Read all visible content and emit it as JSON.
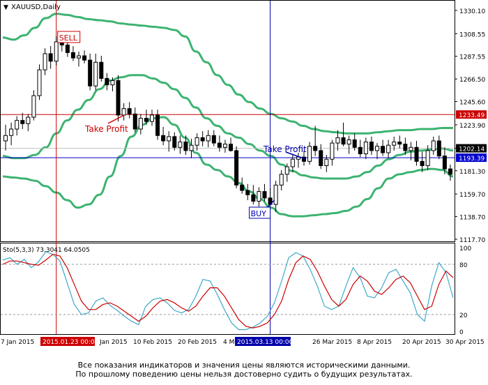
{
  "chart_data": [
    {
      "type": "candlestick",
      "symbol_label": "XAUUSD,Daily",
      "colors": {
        "bull": "#ffffff",
        "bear": "#000000",
        "bollinger": "#3cb371",
        "hline": "#cc0000",
        "vline_sell": "#cc0000",
        "vline_buy": "#0000aa",
        "blue_hline": "#0000cc"
      },
      "x_labels": [
        "7 Jan 2015",
        "Jan 2015",
        "10 Feb 2015",
        "20 Feb 2015",
        "4 M",
        "26 Mar 2015",
        "8 Apr 2015",
        "20 Apr 2015",
        "30 Apr 2015"
      ],
      "x_highlight_left": "2015.01.23 00:00",
      "x_highlight_right": "2015.03.13 00:00",
      "y_ticks": [
        "1330.10",
        "1308.55",
        "1287.55",
        "1266.50",
        "1245.60",
        "1223.90",
        "1202.14",
        "1181.30",
        "1159.70",
        "1138.70",
        "1117.70"
      ],
      "price_markers": [
        {
          "label": "1233.49",
          "color": "#cc0000"
        },
        {
          "label": "1202.14",
          "color": "#000000"
        },
        {
          "label": "1193.39",
          "color": "#0000cc"
        }
      ],
      "annotations": {
        "sell": "SELL",
        "buy": "BUY",
        "take_profit_1": "Take Profit",
        "take_profit_2": "Take Profit"
      },
      "candles": [
        {
          "o": 1209,
          "h": 1224,
          "l": 1200,
          "c": 1214
        },
        {
          "o": 1214,
          "h": 1226,
          "l": 1205,
          "c": 1220
        },
        {
          "o": 1220,
          "h": 1232,
          "l": 1214,
          "c": 1228
        },
        {
          "o": 1228,
          "h": 1235,
          "l": 1220,
          "c": 1225
        },
        {
          "o": 1225,
          "h": 1234,
          "l": 1218,
          "c": 1231
        },
        {
          "o": 1231,
          "h": 1256,
          "l": 1228,
          "c": 1251
        },
        {
          "o": 1251,
          "h": 1280,
          "l": 1247,
          "c": 1275
        },
        {
          "o": 1275,
          "h": 1295,
          "l": 1270,
          "c": 1290
        },
        {
          "o": 1290,
          "h": 1297,
          "l": 1276,
          "c": 1283
        },
        {
          "o": 1283,
          "h": 1306,
          "l": 1279,
          "c": 1301
        },
        {
          "o": 1301,
          "h": 1308,
          "l": 1292,
          "c": 1298
        },
        {
          "o": 1298,
          "h": 1305,
          "l": 1287,
          "c": 1291
        },
        {
          "o": 1291,
          "h": 1297,
          "l": 1283,
          "c": 1286
        },
        {
          "o": 1286,
          "h": 1292,
          "l": 1278,
          "c": 1288
        },
        {
          "o": 1288,
          "h": 1293,
          "l": 1281,
          "c": 1284
        },
        {
          "o": 1284,
          "h": 1290,
          "l": 1256,
          "c": 1260
        },
        {
          "o": 1260,
          "h": 1290,
          "l": 1256,
          "c": 1282
        },
        {
          "o": 1282,
          "h": 1288,
          "l": 1264,
          "c": 1267
        },
        {
          "o": 1267,
          "h": 1272,
          "l": 1256,
          "c": 1261
        },
        {
          "o": 1261,
          "h": 1268,
          "l": 1255,
          "c": 1265
        },
        {
          "o": 1265,
          "h": 1270,
          "l": 1227,
          "c": 1233
        },
        {
          "o": 1233,
          "h": 1244,
          "l": 1228,
          "c": 1239
        },
        {
          "o": 1239,
          "h": 1245,
          "l": 1230,
          "c": 1234
        },
        {
          "o": 1234,
          "h": 1240,
          "l": 1217,
          "c": 1220
        },
        {
          "o": 1220,
          "h": 1234,
          "l": 1215,
          "c": 1230
        },
        {
          "o": 1230,
          "h": 1238,
          "l": 1224,
          "c": 1227
        },
        {
          "o": 1227,
          "h": 1238,
          "l": 1223,
          "c": 1233
        },
        {
          "o": 1233,
          "h": 1238,
          "l": 1210,
          "c": 1214
        },
        {
          "o": 1214,
          "h": 1222,
          "l": 1205,
          "c": 1209
        },
        {
          "o": 1209,
          "h": 1218,
          "l": 1199,
          "c": 1213
        },
        {
          "o": 1213,
          "h": 1217,
          "l": 1200,
          "c": 1203
        },
        {
          "o": 1203,
          "h": 1214,
          "l": 1197,
          "c": 1208
        },
        {
          "o": 1208,
          "h": 1214,
          "l": 1196,
          "c": 1200
        },
        {
          "o": 1200,
          "h": 1211,
          "l": 1193,
          "c": 1205
        },
        {
          "o": 1205,
          "h": 1216,
          "l": 1200,
          "c": 1212
        },
        {
          "o": 1212,
          "h": 1218,
          "l": 1204,
          "c": 1209
        },
        {
          "o": 1209,
          "h": 1219,
          "l": 1203,
          "c": 1214
        },
        {
          "o": 1214,
          "h": 1219,
          "l": 1204,
          "c": 1207
        },
        {
          "o": 1207,
          "h": 1214,
          "l": 1199,
          "c": 1203
        },
        {
          "o": 1203,
          "h": 1210,
          "l": 1198,
          "c": 1206
        },
        {
          "o": 1206,
          "h": 1212,
          "l": 1199,
          "c": 1200
        },
        {
          "o": 1200,
          "h": 1204,
          "l": 1165,
          "c": 1168
        },
        {
          "o": 1168,
          "h": 1175,
          "l": 1160,
          "c": 1163
        },
        {
          "o": 1163,
          "h": 1169,
          "l": 1154,
          "c": 1159
        },
        {
          "o": 1159,
          "h": 1168,
          "l": 1150,
          "c": 1153
        },
        {
          "o": 1153,
          "h": 1166,
          "l": 1148,
          "c": 1162
        },
        {
          "o": 1162,
          "h": 1169,
          "l": 1153,
          "c": 1156
        },
        {
          "o": 1156,
          "h": 1165,
          "l": 1145,
          "c": 1150
        },
        {
          "o": 1150,
          "h": 1172,
          "l": 1143,
          "c": 1168
        },
        {
          "o": 1168,
          "h": 1182,
          "l": 1163,
          "c": 1178
        },
        {
          "o": 1178,
          "h": 1188,
          "l": 1171,
          "c": 1185
        },
        {
          "o": 1185,
          "h": 1197,
          "l": 1180,
          "c": 1192
        },
        {
          "o": 1192,
          "h": 1198,
          "l": 1184,
          "c": 1194
        },
        {
          "o": 1194,
          "h": 1200,
          "l": 1186,
          "c": 1190
        },
        {
          "o": 1190,
          "h": 1208,
          "l": 1187,
          "c": 1204
        },
        {
          "o": 1204,
          "h": 1223,
          "l": 1195,
          "c": 1200
        },
        {
          "o": 1200,
          "h": 1206,
          "l": 1183,
          "c": 1186
        },
        {
          "o": 1186,
          "h": 1196,
          "l": 1180,
          "c": 1192
        },
        {
          "o": 1192,
          "h": 1210,
          "l": 1186,
          "c": 1207
        },
        {
          "o": 1207,
          "h": 1219,
          "l": 1200,
          "c": 1212
        },
        {
          "o": 1212,
          "h": 1226,
          "l": 1204,
          "c": 1206
        },
        {
          "o": 1206,
          "h": 1214,
          "l": 1197,
          "c": 1210
        },
        {
          "o": 1210,
          "h": 1216,
          "l": 1200,
          "c": 1203
        },
        {
          "o": 1203,
          "h": 1210,
          "l": 1194,
          "c": 1197
        },
        {
          "o": 1197,
          "h": 1212,
          "l": 1192,
          "c": 1208
        },
        {
          "o": 1208,
          "h": 1213,
          "l": 1196,
          "c": 1200
        },
        {
          "o": 1200,
          "h": 1207,
          "l": 1192,
          "c": 1204
        },
        {
          "o": 1204,
          "h": 1210,
          "l": 1195,
          "c": 1198
        },
        {
          "o": 1198,
          "h": 1210,
          "l": 1193,
          "c": 1205
        },
        {
          "o": 1205,
          "h": 1213,
          "l": 1200,
          "c": 1208
        },
        {
          "o": 1208,
          "h": 1214,
          "l": 1202,
          "c": 1206
        },
        {
          "o": 1206,
          "h": 1212,
          "l": 1196,
          "c": 1200
        },
        {
          "o": 1200,
          "h": 1208,
          "l": 1191,
          "c": 1203
        },
        {
          "o": 1203,
          "h": 1209,
          "l": 1186,
          "c": 1190
        },
        {
          "o": 1190,
          "h": 1199,
          "l": 1180,
          "c": 1186
        },
        {
          "o": 1186,
          "h": 1205,
          "l": 1182,
          "c": 1200
        },
        {
          "o": 1200,
          "h": 1213,
          "l": 1196,
          "c": 1209
        },
        {
          "o": 1209,
          "h": 1214,
          "l": 1192,
          "c": 1195
        },
        {
          "o": 1195,
          "h": 1203,
          "l": 1178,
          "c": 1183
        },
        {
          "o": 1183,
          "h": 1187,
          "l": 1172,
          "c": 1178
        }
      ],
      "bollinger_upper": [
        1305,
        1303,
        1307,
        1314,
        1323,
        1327,
        1326,
        1324,
        1322,
        1321,
        1320,
        1318,
        1317,
        1316,
        1315,
        1314,
        1312,
        1306,
        1292,
        1282,
        1270,
        1261,
        1252,
        1245,
        1239,
        1234,
        1230,
        1227,
        1223,
        1220,
        1218,
        1217,
        1216,
        1216,
        1216,
        1217,
        1218,
        1219,
        1219,
        1220,
        1220,
        1221,
        1221
      ],
      "bollinger_mid": [
        1195,
        1193,
        1193,
        1196,
        1203,
        1216,
        1228,
        1238,
        1247,
        1257,
        1265,
        1268,
        1270,
        1270,
        1267,
        1263,
        1257,
        1249,
        1240,
        1230,
        1223,
        1216,
        1212,
        1206,
        1200,
        1195,
        1187,
        1181,
        1177,
        1175,
        1174,
        1174,
        1174,
        1176,
        1180,
        1186,
        1192,
        1196,
        1199,
        1200,
        1201,
        1202,
        1200
      ],
      "bollinger_lower": [
        1176,
        1175,
        1174,
        1172,
        1167,
        1161,
        1154,
        1147,
        1150,
        1159,
        1176,
        1195,
        1213,
        1224,
        1230,
        1231,
        1224,
        1212,
        1198,
        1187,
        1182,
        1176,
        1170,
        1162,
        1155,
        1147,
        1141,
        1139,
        1139,
        1140,
        1141,
        1142,
        1144,
        1148,
        1155,
        1165,
        1174,
        1178,
        1180,
        1182,
        1183,
        1182,
        1176
      ],
      "stoch_label": "Sto(5,3,3) 73.3041 64.0505",
      "stoch_ticks": [
        "100",
        "80",
        "20",
        "0"
      ],
      "stoch_main": [
        85,
        88,
        80,
        86,
        76,
        83,
        95,
        92,
        84,
        58,
        32,
        20,
        22,
        36,
        40,
        31,
        25,
        18,
        12,
        8,
        30,
        38,
        40,
        34,
        25,
        22,
        26,
        42,
        62,
        60,
        44,
        26,
        10,
        2,
        2,
        5,
        10,
        18,
        34,
        60,
        88,
        94,
        90,
        74,
        54,
        30,
        26,
        30,
        54,
        76,
        64,
        42,
        40,
        52,
        70,
        74,
        60,
        46,
        20,
        12,
        54,
        82,
        70,
        40
      ],
      "stoch_signal": [
        80,
        84,
        84,
        82,
        80,
        79,
        85,
        92,
        90,
        76,
        56,
        36,
        26,
        26,
        32,
        34,
        30,
        24,
        18,
        12,
        18,
        28,
        36,
        38,
        34,
        28,
        24,
        30,
        42,
        52,
        52,
        42,
        28,
        14,
        6,
        4,
        6,
        10,
        20,
        36,
        62,
        82,
        90,
        86,
        72,
        54,
        38,
        30,
        38,
        56,
        66,
        60,
        48,
        44,
        52,
        62,
        66,
        58,
        42,
        26,
        30,
        56,
        72,
        64
      ]
    }
  ],
  "disclaimer": {
    "line1": "Все показания индикаторов и значения цены являются историческими данными.",
    "line2": "По прошлому поведению цены нельзя достоверно судить о будущих результатах."
  }
}
